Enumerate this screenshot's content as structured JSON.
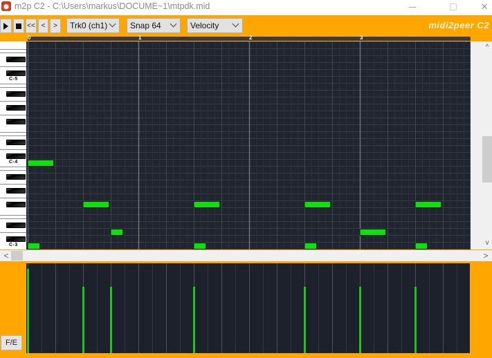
{
  "window": {
    "title": "m2p C2 - C:\\Users\\markus\\DOCUME~1\\mtpdk.mid",
    "minimize_label": "minimize",
    "maximize_label": "maximize",
    "close_glyph": "✕"
  },
  "toolbar": {
    "play_icon": "play-icon",
    "stop_icon": "stop-icon",
    "rewind_label": "<<",
    "back_label": "<",
    "forward_label": ">",
    "track_select": {
      "value": "Trk0 (ch1)"
    },
    "snap_select": {
      "value": "Snap 64"
    },
    "lane_select": {
      "value": "Velocity"
    },
    "brand": "midi2peer C2"
  },
  "ruler": {
    "markers": [
      "0",
      "1",
      "2",
      "3"
    ]
  },
  "piano": {
    "octave_labels": [
      "C-5",
      "C-4",
      "C-3"
    ]
  },
  "colors": {
    "frame": "#ffa600",
    "grid_bg": "#212530",
    "note_fill": "#11dd11",
    "velocity_bar": "#22c422"
  },
  "piano_roll": {
    "visible_bars": 4,
    "beats_per_bar": 4,
    "lowest_visible_note": "C-3",
    "notes": [
      {
        "pitch": "C-4",
        "start_beat": 0.0,
        "length_beats": 0.9375
      },
      {
        "pitch": "C-3",
        "start_beat": 0.0,
        "length_beats": 0.4375
      },
      {
        "pitch": "F#-3",
        "start_beat": 2.0,
        "length_beats": 0.9375
      },
      {
        "pitch": "D-3",
        "start_beat": 3.0,
        "length_beats": 0.4375
      },
      {
        "pitch": "F#-3",
        "start_beat": 6.0,
        "length_beats": 0.9375
      },
      {
        "pitch": "C-3",
        "start_beat": 6.0,
        "length_beats": 0.4375
      },
      {
        "pitch": "F#-3",
        "start_beat": 10.0,
        "length_beats": 0.9375
      },
      {
        "pitch": "C-3",
        "start_beat": 10.0,
        "length_beats": 0.4375
      },
      {
        "pitch": "D-3",
        "start_beat": 12.0,
        "length_beats": 0.9375
      },
      {
        "pitch": "F#-3",
        "start_beat": 14.0,
        "length_beats": 0.9375
      },
      {
        "pitch": "C-3",
        "start_beat": 14.0,
        "length_beats": 0.4375
      }
    ]
  },
  "velocity_lane": {
    "max": 127,
    "events": [
      {
        "beat": 0.0,
        "velocity": 127
      },
      {
        "beat": 2.0,
        "velocity": 100
      },
      {
        "beat": 3.0,
        "velocity": 100
      },
      {
        "beat": 6.0,
        "velocity": 100
      },
      {
        "beat": 10.0,
        "velocity": 100
      },
      {
        "beat": 12.0,
        "velocity": 100
      },
      {
        "beat": 14.0,
        "velocity": 100
      }
    ]
  },
  "scrollbars": {
    "up_glyph": "^",
    "down_glyph": "v",
    "left_glyph": "<",
    "right_glyph": ">"
  },
  "fe_button": "F/E"
}
